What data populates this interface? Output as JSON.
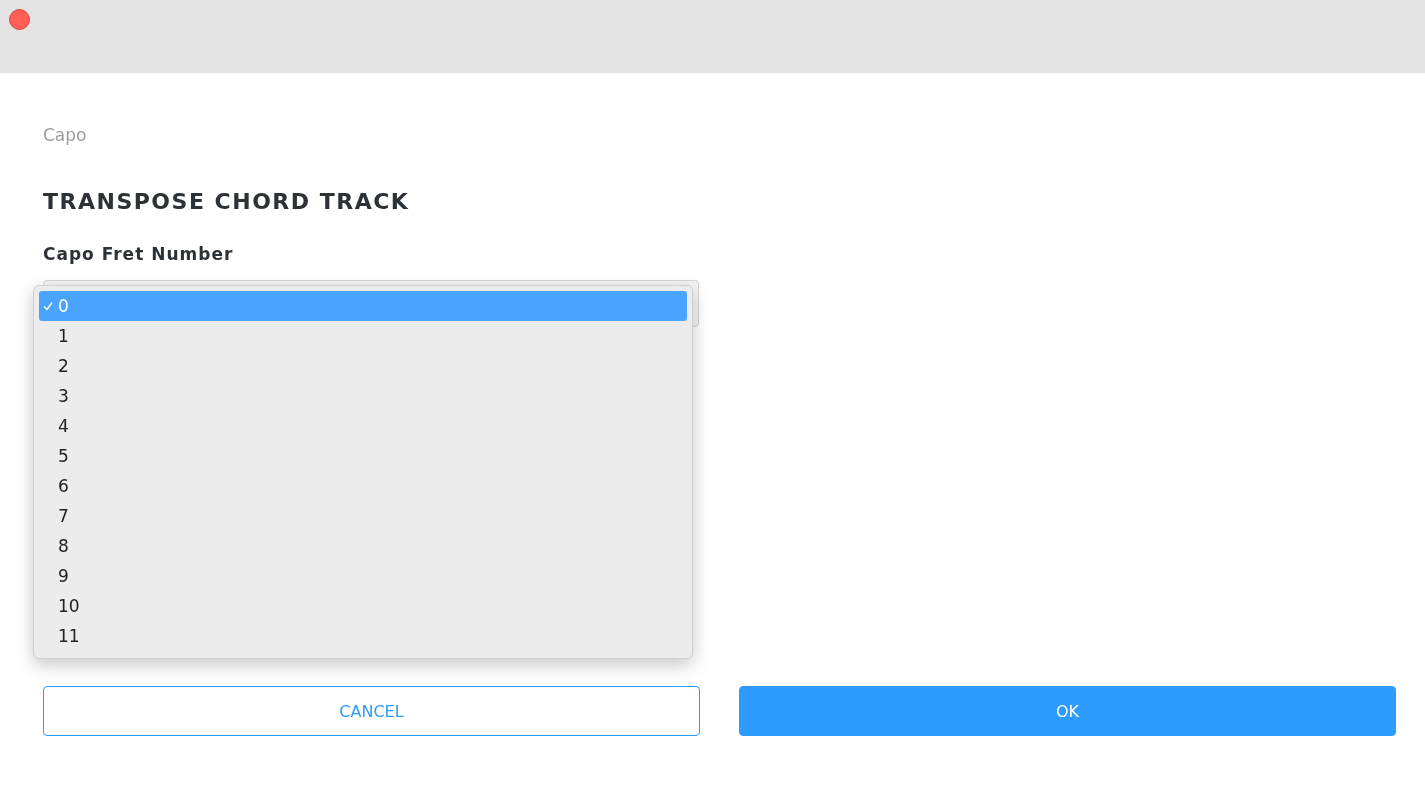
{
  "breadcrumb": "Capo",
  "title": "TRANSPOSE CHORD TRACK",
  "field": {
    "label": "Capo Fret Number",
    "options": [
      {
        "label": "0",
        "selected": true
      },
      {
        "label": "1",
        "selected": false
      },
      {
        "label": "2",
        "selected": false
      },
      {
        "label": "3",
        "selected": false
      },
      {
        "label": "4",
        "selected": false
      },
      {
        "label": "5",
        "selected": false
      },
      {
        "label": "6",
        "selected": false
      },
      {
        "label": "7",
        "selected": false
      },
      {
        "label": "8",
        "selected": false
      },
      {
        "label": "9",
        "selected": false
      },
      {
        "label": "10",
        "selected": false
      },
      {
        "label": "11",
        "selected": false
      }
    ]
  },
  "buttons": [
    {
      "label": "CANCEL",
      "kind": "secondary"
    },
    {
      "label": "OK",
      "kind": "primary"
    }
  ]
}
